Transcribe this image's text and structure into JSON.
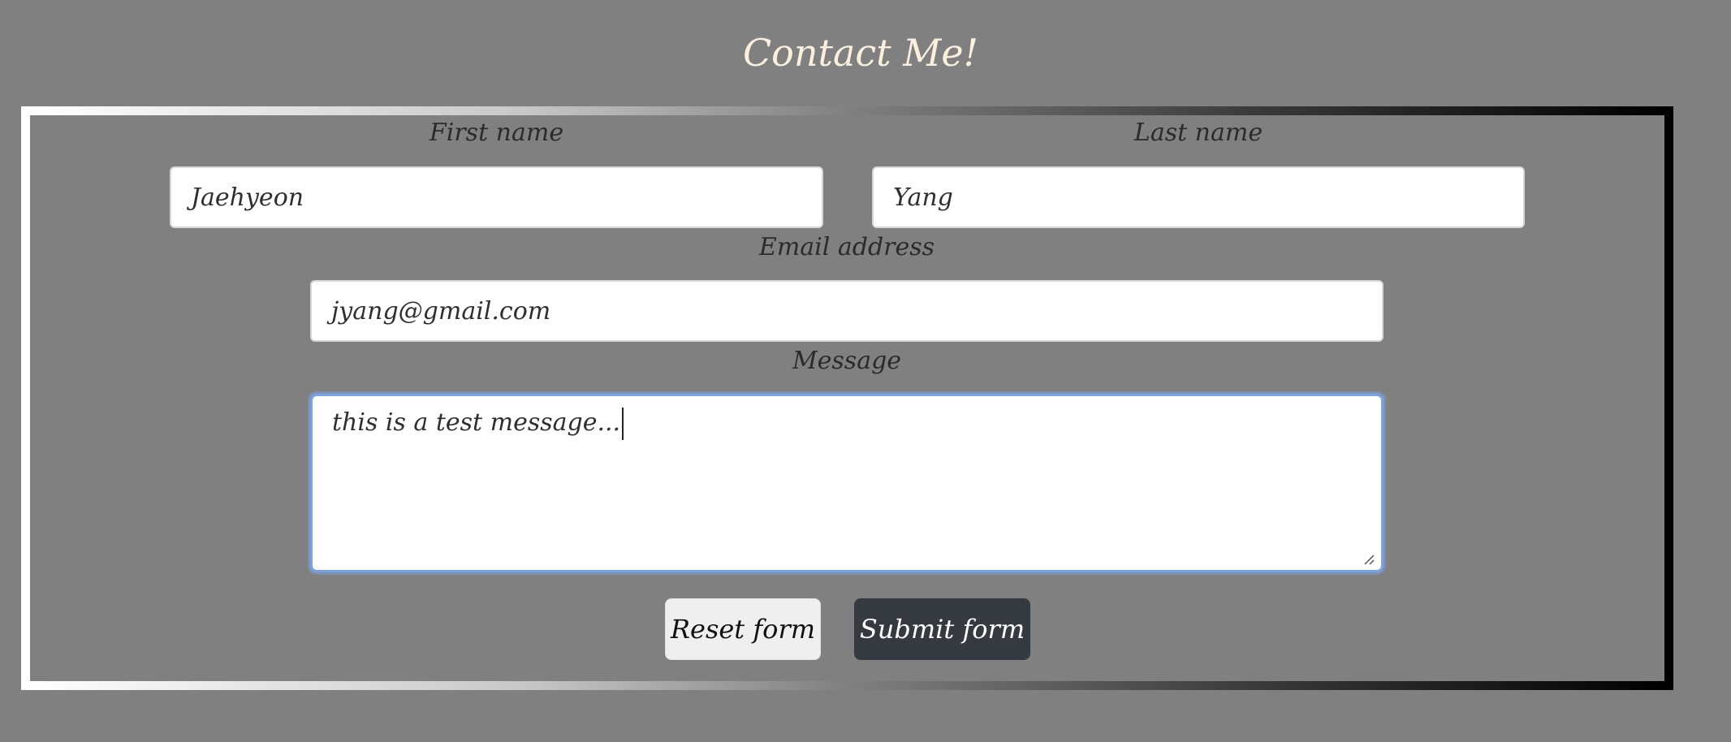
{
  "page": {
    "title": "Contact Me!"
  },
  "form": {
    "first_name": {
      "label": "First name",
      "value": "Jaehyeon"
    },
    "last_name": {
      "label": "Last name",
      "value": "Yang"
    },
    "email": {
      "label": "Email address",
      "value": "jyang@gmail.com"
    },
    "message": {
      "label": "Message",
      "value": "this is a test message..."
    },
    "buttons": {
      "reset_label": "Reset form",
      "submit_label": "Submit form"
    }
  },
  "colors": {
    "background": "#808080",
    "title": "#fbf0dd",
    "submit_button": "#343a40",
    "reset_button": "#efefef",
    "focus_ring": "#7aa3e6"
  },
  "icons": {
    "resize_handle": "textarea-resize-icon"
  }
}
